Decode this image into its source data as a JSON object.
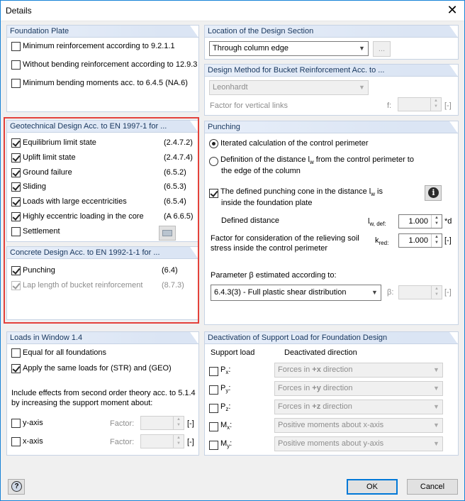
{
  "window": {
    "title": "Details",
    "close_glyph": "✕"
  },
  "foundation_plate": {
    "header": "Foundation Plate",
    "items": [
      {
        "label": "Minimum reinforcement according to 9.2.1.1",
        "checked": false
      },
      {
        "label": "Without bending reinforcement according to 12.9.3",
        "checked": false
      },
      {
        "label": "Minimum bending moments acc. to 6.4.5 (NA.6)",
        "checked": false
      }
    ]
  },
  "geotechnical": {
    "header": "Geotechnical Design Acc. to EN 1997-1 for ...",
    "items": [
      {
        "label": "Equilibrium limit state",
        "ref": "(2.4.7.2)",
        "checked": true
      },
      {
        "label": "Uplift limit state",
        "ref": "(2.4.7.4)",
        "checked": true
      },
      {
        "label": "Ground failure",
        "ref": "(6.5.2)",
        "checked": true
      },
      {
        "label": "Sliding",
        "ref": "(6.5.3)",
        "checked": true
      },
      {
        "label": "Loads with large eccentricities",
        "ref": "(6.5.4)",
        "checked": true
      },
      {
        "label": "Highly eccentric loading in the core",
        "ref": "(A 6.6.5)",
        "checked": true
      },
      {
        "label": "Settlement",
        "ref": "",
        "checked": false
      }
    ]
  },
  "concrete": {
    "header": "Concrete Design Acc. to EN 1992-1-1 for ...",
    "items": [
      {
        "label": "Punching",
        "ref": "(6.4)",
        "checked": true
      },
      {
        "label": "Lap length of bucket reinforcement",
        "ref": "(8.7.3)",
        "checked": true
      }
    ]
  },
  "location": {
    "header": "Location of the Design Section",
    "value": "Through column edge",
    "more_button": "..."
  },
  "bucket": {
    "header": "Design Method for Bucket Reinforcement Acc. to ...",
    "method": "Leonhardt",
    "factor_label": "Factor for vertical links",
    "f_label": "f:",
    "unit": "[-]"
  },
  "punching": {
    "header": "Punching",
    "radio_iterated": "Iterated calculation of the control perimeter",
    "radio_definition_line1": "Definition of the distance l",
    "radio_definition_sub": "w",
    "radio_definition_line1b": " from the control perimeter to",
    "radio_definition_line2": "the edge of the column",
    "cone_line1": "The defined punching cone in the distance l",
    "cone_sub": "w",
    "cone_line1b": " is",
    "cone_line2": "inside the foundation plate",
    "defined_distance_label": "Defined distance",
    "lw_def_symbol": "l",
    "lw_def_sub": "w, def:",
    "lw_def_value": "1.000",
    "lw_def_unit": "*d",
    "factor_line1": "Factor for consideration of the relieving soil",
    "factor_line2": "stress inside the control perimeter",
    "kred_symbol": "k",
    "kred_sub": "red:",
    "kred_value": "1.000",
    "kred_unit": "[-]",
    "beta_label": "Parameter β estimated according to:",
    "beta_value": "6.4.3(3) - Full plastic shear distribution",
    "beta_symbol": "β:",
    "beta_unit": "[-]"
  },
  "loads": {
    "header": "Loads in Window 1.4",
    "equal_label": "Equal for all foundations",
    "apply_label": "Apply the same loads for (STR) and (GEO)",
    "include_line1": "Include effects from second order theory acc. to 5.1.4",
    "include_line2": "by increasing the support moment about:",
    "y_axis": "y-axis",
    "x_axis": "x-axis",
    "factor_label": "Factor:",
    "unit": "[-]"
  },
  "deactivation": {
    "header": "Deactivation of Support Load for Foundation Design",
    "col_support": "Support load",
    "col_direction": "Deactivated direction",
    "rows": [
      {
        "symbol": "P",
        "sub": "x",
        "suffix": ":",
        "direction": "Forces in +x direction",
        "bold": "+x"
      },
      {
        "symbol": "P",
        "sub": "y",
        "suffix": ":",
        "direction": "Forces in +y direction",
        "bold": "+y"
      },
      {
        "symbol": "P",
        "sub": "z",
        "suffix": ":",
        "direction": "Forces in +z direction",
        "bold": "+z"
      },
      {
        "symbol": "M",
        "sub": "x",
        "suffix": ":",
        "direction": "Positive moments about x-axis",
        "bold": ""
      },
      {
        "symbol": "M",
        "sub": "y",
        "suffix": ":",
        "direction": "Positive moments about y-axis",
        "bold": ""
      }
    ]
  },
  "footer": {
    "ok": "OK",
    "cancel": "Cancel"
  },
  "colors": {
    "highlight": "#e3413b",
    "panel_header": "#dbe5f4",
    "accent": "#0078d7"
  }
}
